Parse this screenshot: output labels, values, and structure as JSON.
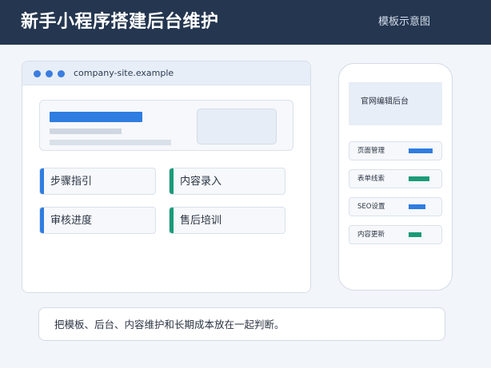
{
  "header": {
    "title": "新手小程序搭建后台维护",
    "tag": "模板示意图"
  },
  "browser": {
    "url": "company-site.example",
    "cards": [
      {
        "label": "步骤指引",
        "accent": "#2f7de1"
      },
      {
        "label": "内容录入",
        "accent": "#1a9b78"
      },
      {
        "label": "审核进度",
        "accent": "#2f7de1"
      },
      {
        "label": "售后培训",
        "accent": "#1a9b78"
      }
    ]
  },
  "phone": {
    "title": "官网编辑后台",
    "rows": [
      {
        "label": "页面管理",
        "color": "#2f7de1"
      },
      {
        "label": "表单线索",
        "color": "#1a9b78"
      },
      {
        "label": "SEO设置",
        "color": "#2f7de1"
      },
      {
        "label": "内容更新",
        "color": "#1a9b78"
      }
    ]
  },
  "note": {
    "text": "把模板、后台、内容维护和长期成本放在一起判断。"
  },
  "colors": {
    "header_bg": "#243650",
    "accent_blue": "#2f7de1",
    "accent_green": "#1a9b78"
  }
}
